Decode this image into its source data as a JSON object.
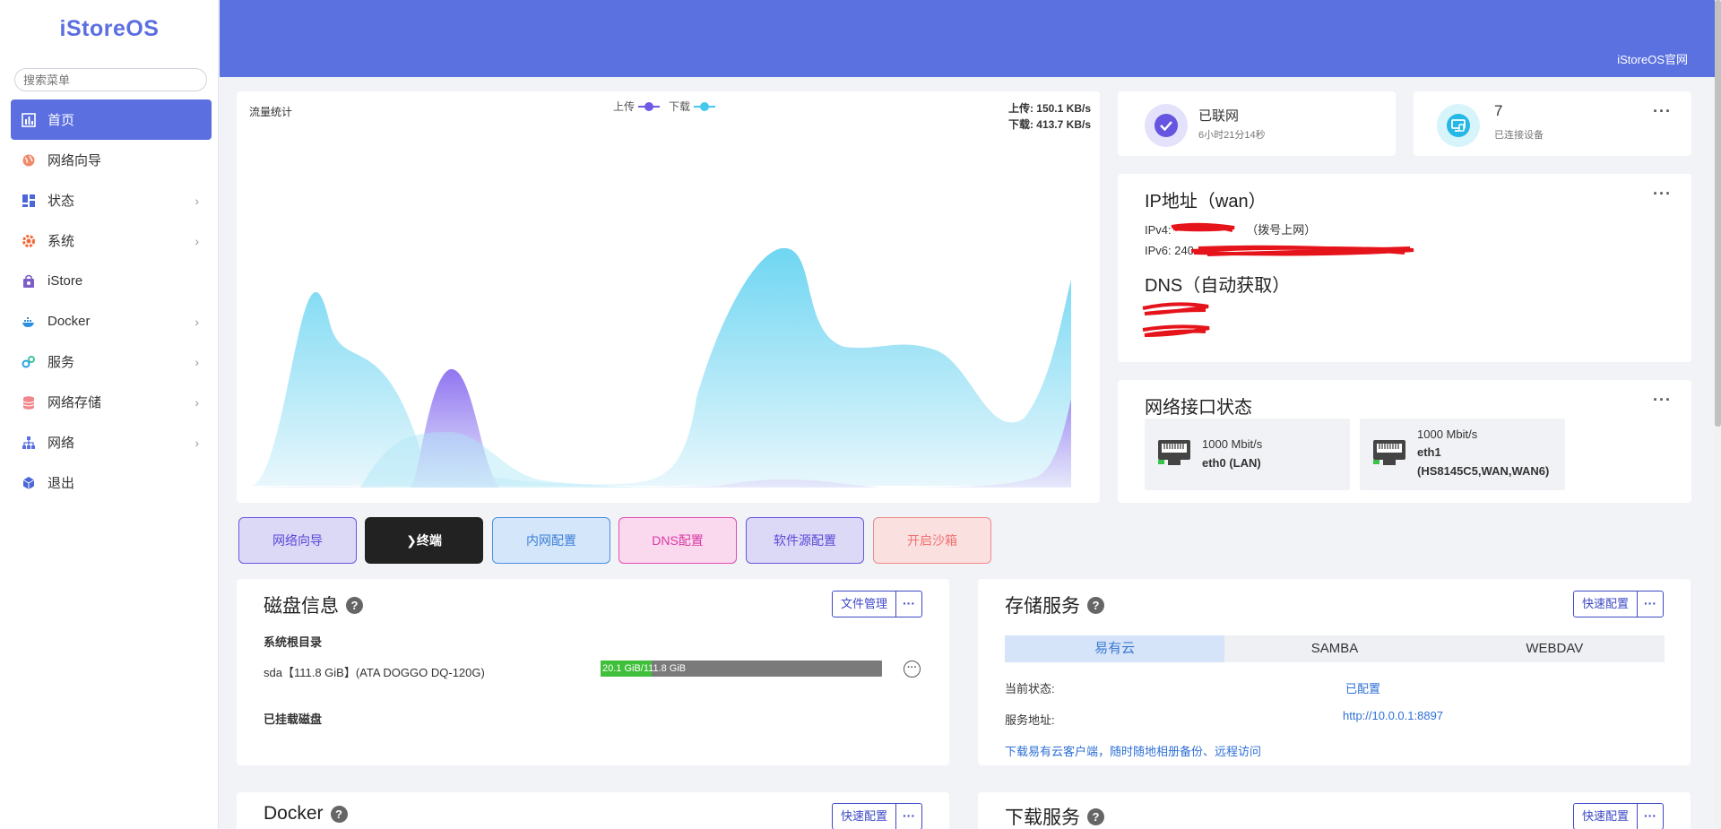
{
  "sidebar": {
    "logo": "iStoreOS",
    "search_placeholder": "搜索菜单",
    "items": [
      {
        "label": "首页"
      },
      {
        "label": "网络向导"
      },
      {
        "label": "状态"
      },
      {
        "label": "系统"
      },
      {
        "label": "iStore"
      },
      {
        "label": "Docker"
      },
      {
        "label": "服务"
      },
      {
        "label": "网络存储"
      },
      {
        "label": "网络"
      },
      {
        "label": "退出"
      }
    ]
  },
  "header": {
    "link": "iStoreOS官网"
  },
  "traffic": {
    "title": "流量统计",
    "legend_up": "上传",
    "legend_down": "下载",
    "rate_up": "上传: 150.1 KB/s",
    "rate_down": "下载: 413.7 KB/s",
    "colors": {
      "up": "#6d5ae6",
      "down": "#45c8ec"
    }
  },
  "network": {
    "status": "已联网",
    "uptime": "6小时21分14秒"
  },
  "devices": {
    "count": "7",
    "label": "已连接设备"
  },
  "ip": {
    "title": "IP地址（wan）",
    "ipv4_prefix": "IPv4: ",
    "ipv4_suffix": "（拨号上网）",
    "ipv6_prefix": "IPv6: 240",
    "dns_title": "DNS（自动获取）"
  },
  "interfaces": {
    "title": "网络接口状态",
    "items": [
      {
        "speed": "1000 Mbit/s",
        "name": "eth0 (LAN)"
      },
      {
        "speed": "1000 Mbit/s",
        "name": "eth1",
        "detail": "(HS8145C5,WAN,WAN6)"
      }
    ]
  },
  "quick_buttons": [
    "网络向导",
    "❯终端",
    "内网配置",
    "DNS配置",
    "软件源配置",
    "开启沙箱"
  ],
  "disk": {
    "title": "磁盘信息",
    "manage": "文件管理",
    "root_title": "系统根目录",
    "sda": "sda【111.8 GiB】(ATA DOGGO DQ-120G)",
    "usage_text": "20.1 GiB/111.8 GiB",
    "usage_fraction": 0.18,
    "mounted_title": "已挂载磁盘"
  },
  "storage": {
    "title": "存储服务",
    "quick": "快速配置",
    "tabs": [
      "易有云",
      "SAMBA",
      "WEBDAV"
    ],
    "status_label": "当前状态:",
    "status_value": "已配置",
    "addr_label": "服务地址:",
    "addr_value": "http://10.0.0.1:8897",
    "download_link": "下载易有云客户端，随时随地相册备份、远程访问"
  },
  "docker": {
    "title": "Docker",
    "quick": "快速配置"
  },
  "download": {
    "title": "下载服务",
    "quick": "快速配置"
  },
  "more": "···",
  "help": "?"
}
